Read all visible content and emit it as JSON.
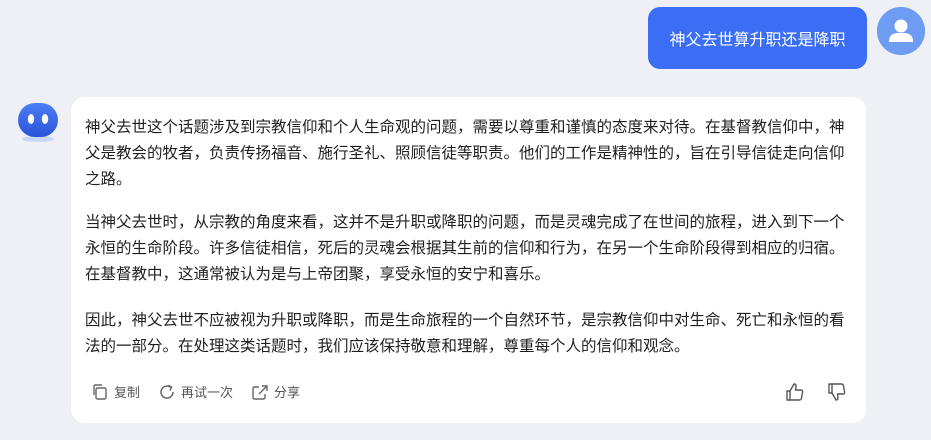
{
  "user_message": {
    "text": "神父去世算升职还是降职"
  },
  "bot_message": {
    "paragraphs": [
      "神父去世这个话题涉及到宗教信仰和个人生命观的问题，需要以尊重和谨慎的态度来对待。在基督教信仰中，神父是教会的牧者，负责传扬福音、施行圣礼、照顾信徒等职责。他们的工作是精神性的，旨在引导信徒走向信仰之路。",
      "当神父去世时，从宗教的角度来看，这并不是升职或降职的问题，而是灵魂完成了在世间的旅程，进入到下一个永恒的生命阶段。许多信徒相信，死后的灵魂会根据其生前的信仰和行为，在另一个生命阶段得到相应的归宿。在基督教中，这通常被认为是与上帝团聚，享受永恒的安宁和喜乐。",
      "因此，神父去世不应被视为升职或降职，而是生命旅程的一个自然环节，是宗教信仰中对生命、死亡和永恒的看法的一部分。在处理这类话题时，我们应该保持敬意和理解，尊重每个人的信仰和观念。"
    ]
  },
  "actions": {
    "copy_label": "复制",
    "retry_label": "再试一次",
    "share_label": "分享"
  },
  "colors": {
    "accent": "#3b6ef5",
    "background": "#eef0f6"
  }
}
